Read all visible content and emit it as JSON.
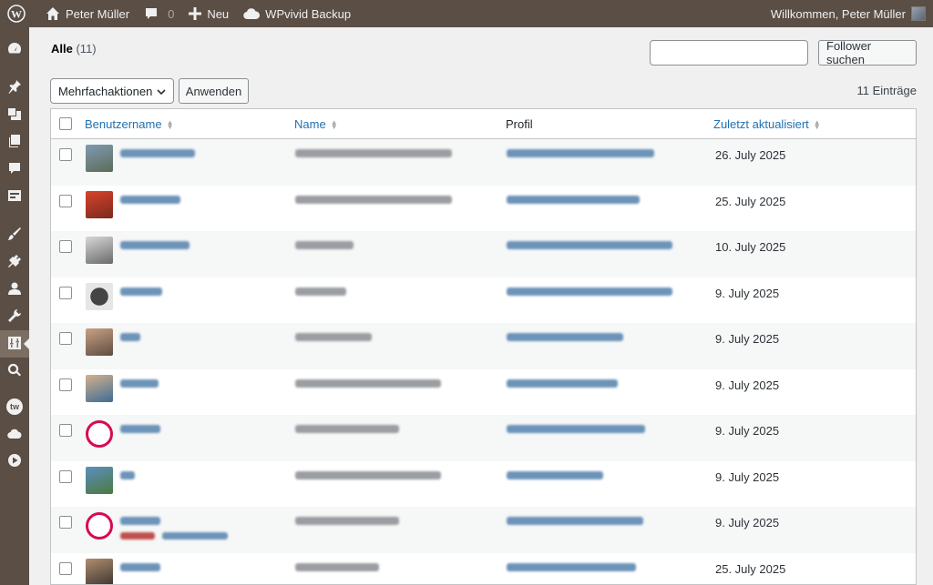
{
  "adminbar": {
    "site_name": "Peter Müller",
    "comments_count": "0",
    "new_label": "Neu",
    "plugin_label": "WPvivid Backup",
    "greeting": "Willkommen, Peter Müller"
  },
  "sidebar": {
    "icons": [
      "dashboard-icon",
      "pin-icon",
      "media-icon",
      "pages-icon",
      "comments-icon",
      "forms-icon",
      "appearance-icon",
      "plugins-icon",
      "users-icon",
      "tools-icon",
      "settings-icon",
      "search-icon",
      "tw-icon",
      "cloud-icon",
      "play-icon"
    ],
    "tw_label": "tw"
  },
  "filters": {
    "all_label": "Alle",
    "all_count": "(11)"
  },
  "search": {
    "value": "",
    "button": "Follower suchen"
  },
  "bulk": {
    "selected": "Mehrfachaktionen",
    "apply": "Anwenden"
  },
  "entries": "11 Einträge",
  "table": {
    "columns": {
      "username": "Benutzername",
      "name": "Name",
      "profile": "Profil",
      "updated": "Zuletzt aktualisiert"
    },
    "rows": [
      {
        "date": "26. July 2025"
      },
      {
        "date": "25. July 2025"
      },
      {
        "date": "10. July 2025"
      },
      {
        "date": "9. July 2025"
      },
      {
        "date": "9. July 2025"
      },
      {
        "date": "9. July 2025"
      },
      {
        "date": "9. July 2025"
      },
      {
        "date": "9. July 2025"
      },
      {
        "date": "9. July 2025"
      },
      {
        "date": "25. July 2025"
      }
    ]
  },
  "colors": {
    "adminbar": "#5a4e45",
    "link": "#2271b1",
    "delete": "#b32d2e"
  }
}
